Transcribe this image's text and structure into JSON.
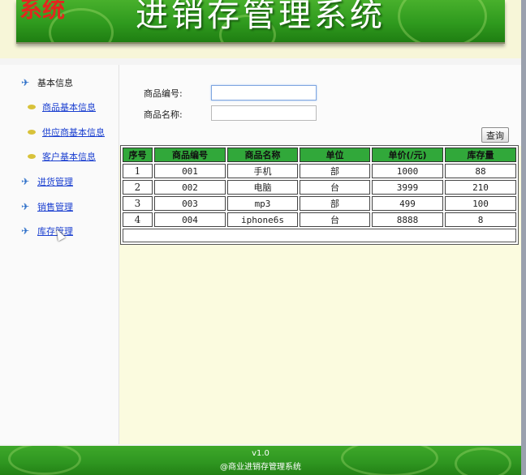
{
  "header": {
    "title": "进销存管理系统",
    "logo_text": "系统"
  },
  "sidebar": {
    "items": [
      {
        "label": "基本信息",
        "icon": "bird-icon",
        "type": "heading"
      },
      {
        "label": "商品基本信息",
        "icon": "leaf-icon",
        "type": "link"
      },
      {
        "label": "供应商基本信息",
        "icon": "leaf-icon",
        "type": "link"
      },
      {
        "label": "客户基本信息",
        "icon": "leaf-icon",
        "type": "link"
      },
      {
        "label": "进货管理",
        "icon": "bird-icon",
        "type": "link"
      },
      {
        "label": "销售管理",
        "icon": "bird-icon",
        "type": "link"
      },
      {
        "label": "库存管理",
        "icon": "bird-icon",
        "type": "link"
      }
    ]
  },
  "search": {
    "code_label": "商品编号:",
    "code_value": "",
    "name_label": "商品名称:",
    "name_value": "",
    "button_label": "查询"
  },
  "table": {
    "headers": [
      "序号",
      "商品编号",
      "商品名称",
      "单位",
      "单价(/元)",
      "库存量"
    ],
    "rows": [
      [
        "1",
        "001",
        "手机",
        "部",
        "1000",
        "88"
      ],
      [
        "2",
        "002",
        "电脑",
        "台",
        "3999",
        "210"
      ],
      [
        "3",
        "003",
        "mp3",
        "部",
        "499",
        "100"
      ],
      [
        "4",
        "004",
        "iphone6s",
        "台",
        "8888",
        "8"
      ]
    ]
  },
  "footer": {
    "version": "v1.0",
    "copyright": "@商业进销存管理系统"
  },
  "colors": {
    "banner_green": "#2f9a1e",
    "header_cell_green": "#31a83a",
    "link_blue": "#1a3fd0",
    "content_bg": "#fbfbdf"
  }
}
